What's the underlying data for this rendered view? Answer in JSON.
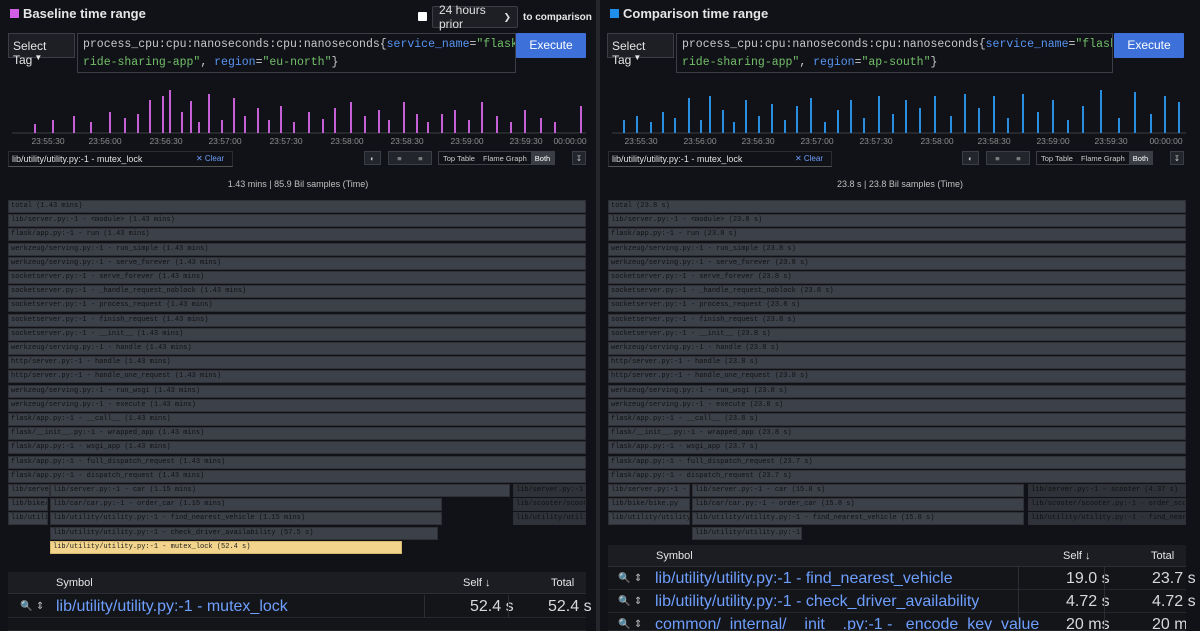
{
  "left": {
    "title": "Baseline time range",
    "accent": "#d25ee5",
    "time_select": "24 hours prior",
    "to_comparison": "to comparison",
    "select_tag": "Select Tag",
    "query_prefix": "process_cpu:cpu:nanoseconds:cpu:nanoseconds{",
    "query_k1": "service_name",
    "query_eq1": "=",
    "query_v1": "\"flask-ride-sharing-app\"",
    "query_sep": ", ",
    "query_k2": "region",
    "query_eq2": "=",
    "query_v2": "\"eu-north\"",
    "query_suffix": "}",
    "execute": "Execute",
    "ticks": [
      "23:55:30",
      "23:56:00",
      "23:56:30",
      "23:57:00",
      "23:57:30",
      "23:58:00",
      "23:58:30",
      "23:59:00",
      "23:59:30",
      "00:00:00"
    ],
    "filter": "lib/utility/utility.py:-1 - mutex_lock",
    "clear": "Clear",
    "views": [
      "Top Table",
      "Flame Graph",
      "Both"
    ],
    "info": "1.43 mins | 85.9 Bil samples (Time)",
    "flame": [
      "total (1.43 mins)",
      "lib/server.py:-1 - <module> (1.43 mins)",
      "flask/app.py:-1 - run (1.43 mins)",
      "werkzeug/serving.py:-1 - run_simple (1.43 mins)",
      "werkzeug/serving.py:-1 - serve_forever (1.43 mins)",
      "socketserver.py:-1 - serve_forever (1.43 mins)",
      "socketserver.py:-1 - _handle_request_noblock (1.43 mins)",
      "socketserver.py:-1 - process_request (1.43 mins)",
      "socketserver.py:-1 - finish_request (1.43 mins)",
      "socketserver.py:-1 - __init__ (1.43 mins)",
      "werkzeug/serving.py:-1 - handle (1.43 mins)",
      "http/server.py:-1 - handle (1.43 mins)",
      "http/server.py:-1 - handle_one_request (1.43 mins)",
      "werkzeug/serving.py:-1 - run_wsgi (1.43 mins)",
      "werkzeug/serving.py:-1 - execute (1.43 mins)",
      "flask/app.py:-1 - __call__ (1.43 mins)",
      "flask/__init__.py:-1 - wrapped_app (1.43 mins)",
      "flask/app.py:-1 - wsgi_app (1.43 mins)",
      "flask/app.py:-1 - full_dispatch_request (1.43 mins)",
      "flask/app.py:-1 - dispatch_request (1.43 mins)"
    ],
    "flame_r21": [
      "lib/server.py:-1 - car (1.43 mins)",
      "lib/server.py:-1 - car (1.15 mins)",
      "lib/server.py:-1"
    ],
    "flame_r22": [
      "lib/bike/bike.py",
      "lib/car/car.py:-1 - order_car (1.15 mins)",
      "lib/scooter/scoote"
    ],
    "flame_r23": [
      "lib/utility/utility.py",
      "lib/utility/utility.py:-1 - find_nearest_vehicle (1.15 mins)",
      "lib/utility/utili"
    ],
    "flame_r24": "lib/utility/utility.py:-1 - check_driver_availability (57.5 s)",
    "flame_r25": "lib/utility/utility.py:-1 - mutex_lock (52.4 s)",
    "table": {
      "symbol": "Symbol",
      "self": "Self",
      "total": "Total",
      "rows": [
        {
          "symbol": "lib/utility/utility.py:-1 - mutex_lock",
          "self": "52.4 s",
          "total": "52.4 s"
        }
      ]
    }
  },
  "right": {
    "title": "Comparison time range",
    "accent": "#1f8fec",
    "select_tag": "Select Tag",
    "query_prefix": "process_cpu:cpu:nanoseconds:cpu:nanoseconds{",
    "query_k1": "service_name",
    "query_eq1": "=",
    "query_v1": "\"flask-ride-sharing-app\"",
    "query_sep": ", ",
    "query_k2": "region",
    "query_eq2": "=",
    "query_v2": "\"ap-south\"",
    "query_suffix": "}",
    "execute": "Execute",
    "ticks": [
      "23:55:30",
      "23:56:00",
      "23:56:30",
      "23:57:00",
      "23:57:30",
      "23:58:00",
      "23:58:30",
      "23:59:00",
      "23:59:30",
      "00:00:00"
    ],
    "filter": "lib/utility/utility.py:-1 - mutex_lock",
    "clear": "Clear",
    "views": [
      "Top Table",
      "Flame Graph",
      "Both"
    ],
    "info": "23.8 s | 23.8 Bil samples (Time)",
    "flame": [
      "total (23.8 s)",
      "lib/server.py:-1 - <module> (23.8 s)",
      "flask/app.py:-1 - run (23.8 s)",
      "werkzeug/serving.py:-1 - run_simple (23.8 s)",
      "werkzeug/serving.py:-1 - serve_forever (23.8 s)",
      "socketserver.py:-1 - serve_forever (23.8 s)",
      "socketserver.py:-1 - _handle_request_noblock (23.8 s)",
      "socketserver.py:-1 - process_request (23.8 s)",
      "socketserver.py:-1 - finish_request (23.8 s)",
      "socketserver.py:-1 - __init__ (23.8 s)",
      "werkzeug/serving.py:-1 - handle (23.8 s)",
      "http/server.py:-1 - handle (23.8 s)",
      "http/server.py:-1 - handle_one_request (23.8 s)",
      "werkzeug/serving.py:-1 - run_wsgi (23.8 s)",
      "werkzeug/serving.py:-1 - execute (23.8 s)",
      "flask/app.py:-1 - __call__ (23.8 s)",
      "flask/__init__.py:-1 - wrapped_app (23.8 s)",
      "flask/app.py:-1 - wsgi_app (23.7 s)",
      "flask/app.py:-1 - full_dispatch_request (23.7 s)",
      "flask/app.py:-1 - dispatch_request (23.7 s)"
    ],
    "flame_r21": [
      "lib/server.py:-1 - b",
      "lib/server.py:-1 - car (15.8 s)",
      "lib/server.py:-1 - scooter (4.37 s)"
    ],
    "flame_r22": [
      "lib/bike/bike.py",
      "lib/car/car.py:-1 - order_car (15.8 s)",
      "lib/scooter/scooter.py:-1 - order_scoo"
    ],
    "flame_r23": [
      "lib/utility/utility",
      "lib/utility/utility.py:-1 - find_nearest_vehicle (15.8 s)",
      "lib/utility/utility.py:-1 - find_neare"
    ],
    "flame_r24": "lib/utility/utility.py:-1 - ...",
    "table": {
      "symbol": "Symbol",
      "self": "Self",
      "total": "Total",
      "rows": [
        {
          "symbol": "lib/utility/utility.py:-1 - find_nearest_vehicle",
          "self": "19.0 s",
          "total": "23.7 s"
        },
        {
          "symbol": "lib/utility/utility.py:-1 - check_driver_availability",
          "self": "4.72 s",
          "total": "4.72 s"
        },
        {
          "symbol": "common/_internal/__init__.py:-1 - _encode_key_value",
          "self": "20 ms",
          "total": "20 ms"
        }
      ]
    }
  }
}
